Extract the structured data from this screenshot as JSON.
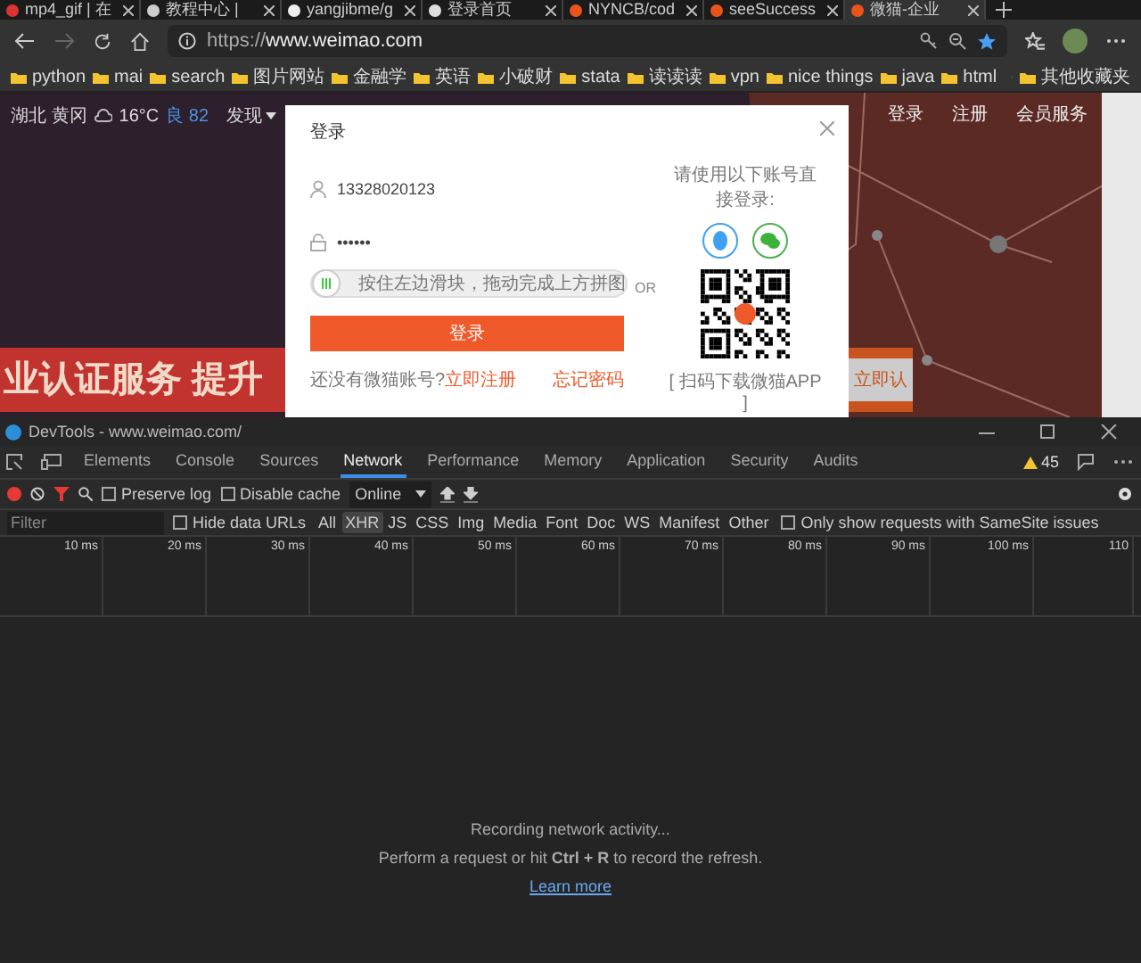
{
  "browser": {
    "tabs": [
      {
        "title": "mp4_gif | 在",
        "selected": false,
        "kind": "gif"
      },
      {
        "title": "教程中心 | ",
        "selected": false,
        "kind": "shield"
      },
      {
        "title": "yangjibme/g",
        "selected": false,
        "kind": "github"
      },
      {
        "title": "登录首页",
        "selected": false,
        "kind": "page"
      },
      {
        "title": "NYNCB/cod",
        "selected": false,
        "kind": "smile"
      },
      {
        "title": "seeSuccess",
        "selected": false,
        "kind": "note"
      },
      {
        "title": "微猫-企业",
        "selected": true,
        "kind": "brand"
      }
    ],
    "url": {
      "prefix": "https://",
      "host": "www.weimao.com"
    },
    "bookmarks": [
      "python",
      "mai",
      "search",
      "图片网站",
      "金融学",
      "英语",
      "小破财",
      "stata",
      "读读读",
      "vpn",
      "nice things",
      "java",
      "html"
    ],
    "other_bookmarks": "其他收藏夹"
  },
  "page": {
    "location": "湖北 黄冈",
    "temperature": "16°C",
    "air_quality": "良 82",
    "discover": "发现",
    "nav": [
      "登录",
      "注册",
      "会员服务"
    ],
    "banner": "业认证服务   提升",
    "banner_button": "立即认",
    "login": {
      "title": "登录",
      "username": "13328020123",
      "password": "••••••",
      "captcha_hint": "按住左边滑块，拖动完成上方拼图",
      "submit": "登录",
      "no_account": "还没有微猫账号?",
      "register": "立即注册",
      "forgot": "忘记密码",
      "or": "OR",
      "social_prompt": "请使用以下账号直接登录:",
      "qr_caption": "[ 扫码下载微猫APP ]"
    }
  },
  "devtools": {
    "title": "DevTools - www.weimao.com/",
    "tabs": [
      {
        "label": "Elements",
        "selected": false
      },
      {
        "label": "Console",
        "selected": false
      },
      {
        "label": "Sources",
        "selected": false
      },
      {
        "label": "Network",
        "selected": true
      },
      {
        "label": "Performance",
        "selected": false
      },
      {
        "label": "Memory",
        "selected": false
      },
      {
        "label": "Application",
        "selected": false
      },
      {
        "label": "Security",
        "selected": false
      },
      {
        "label": "Audits",
        "selected": false
      }
    ],
    "warnings": "45",
    "preserve_log": {
      "label": "Preserve log",
      "checked": false
    },
    "disable_cache": {
      "label": "Disable cache",
      "checked": false
    },
    "throttle": "Online",
    "filter_placeholder": "Filter",
    "hide_data_urls": {
      "label": "Hide data URLs",
      "checked": false
    },
    "types": [
      {
        "label": "All",
        "selected": false
      },
      {
        "label": "XHR",
        "selected": true
      },
      {
        "label": "JS",
        "selected": false
      },
      {
        "label": "CSS",
        "selected": false
      },
      {
        "label": "Img",
        "selected": false
      },
      {
        "label": "Media",
        "selected": false
      },
      {
        "label": "Font",
        "selected": false
      },
      {
        "label": "Doc",
        "selected": false
      },
      {
        "label": "WS",
        "selected": false
      },
      {
        "label": "Manifest",
        "selected": false
      },
      {
        "label": "Other",
        "selected": false
      }
    ],
    "samesite": {
      "label": "Only show requests with SameSite issues",
      "checked": false
    },
    "ticks": [
      "10 ms",
      "20 ms",
      "30 ms",
      "40 ms",
      "50 ms",
      "60 ms",
      "70 ms",
      "80 ms",
      "90 ms",
      "100 ms",
      "110"
    ],
    "empty": {
      "title": "Recording network activity...",
      "hint": "Perform a request or hit **Ctrl + R** to record the refresh.",
      "link": "Learn more"
    }
  }
}
